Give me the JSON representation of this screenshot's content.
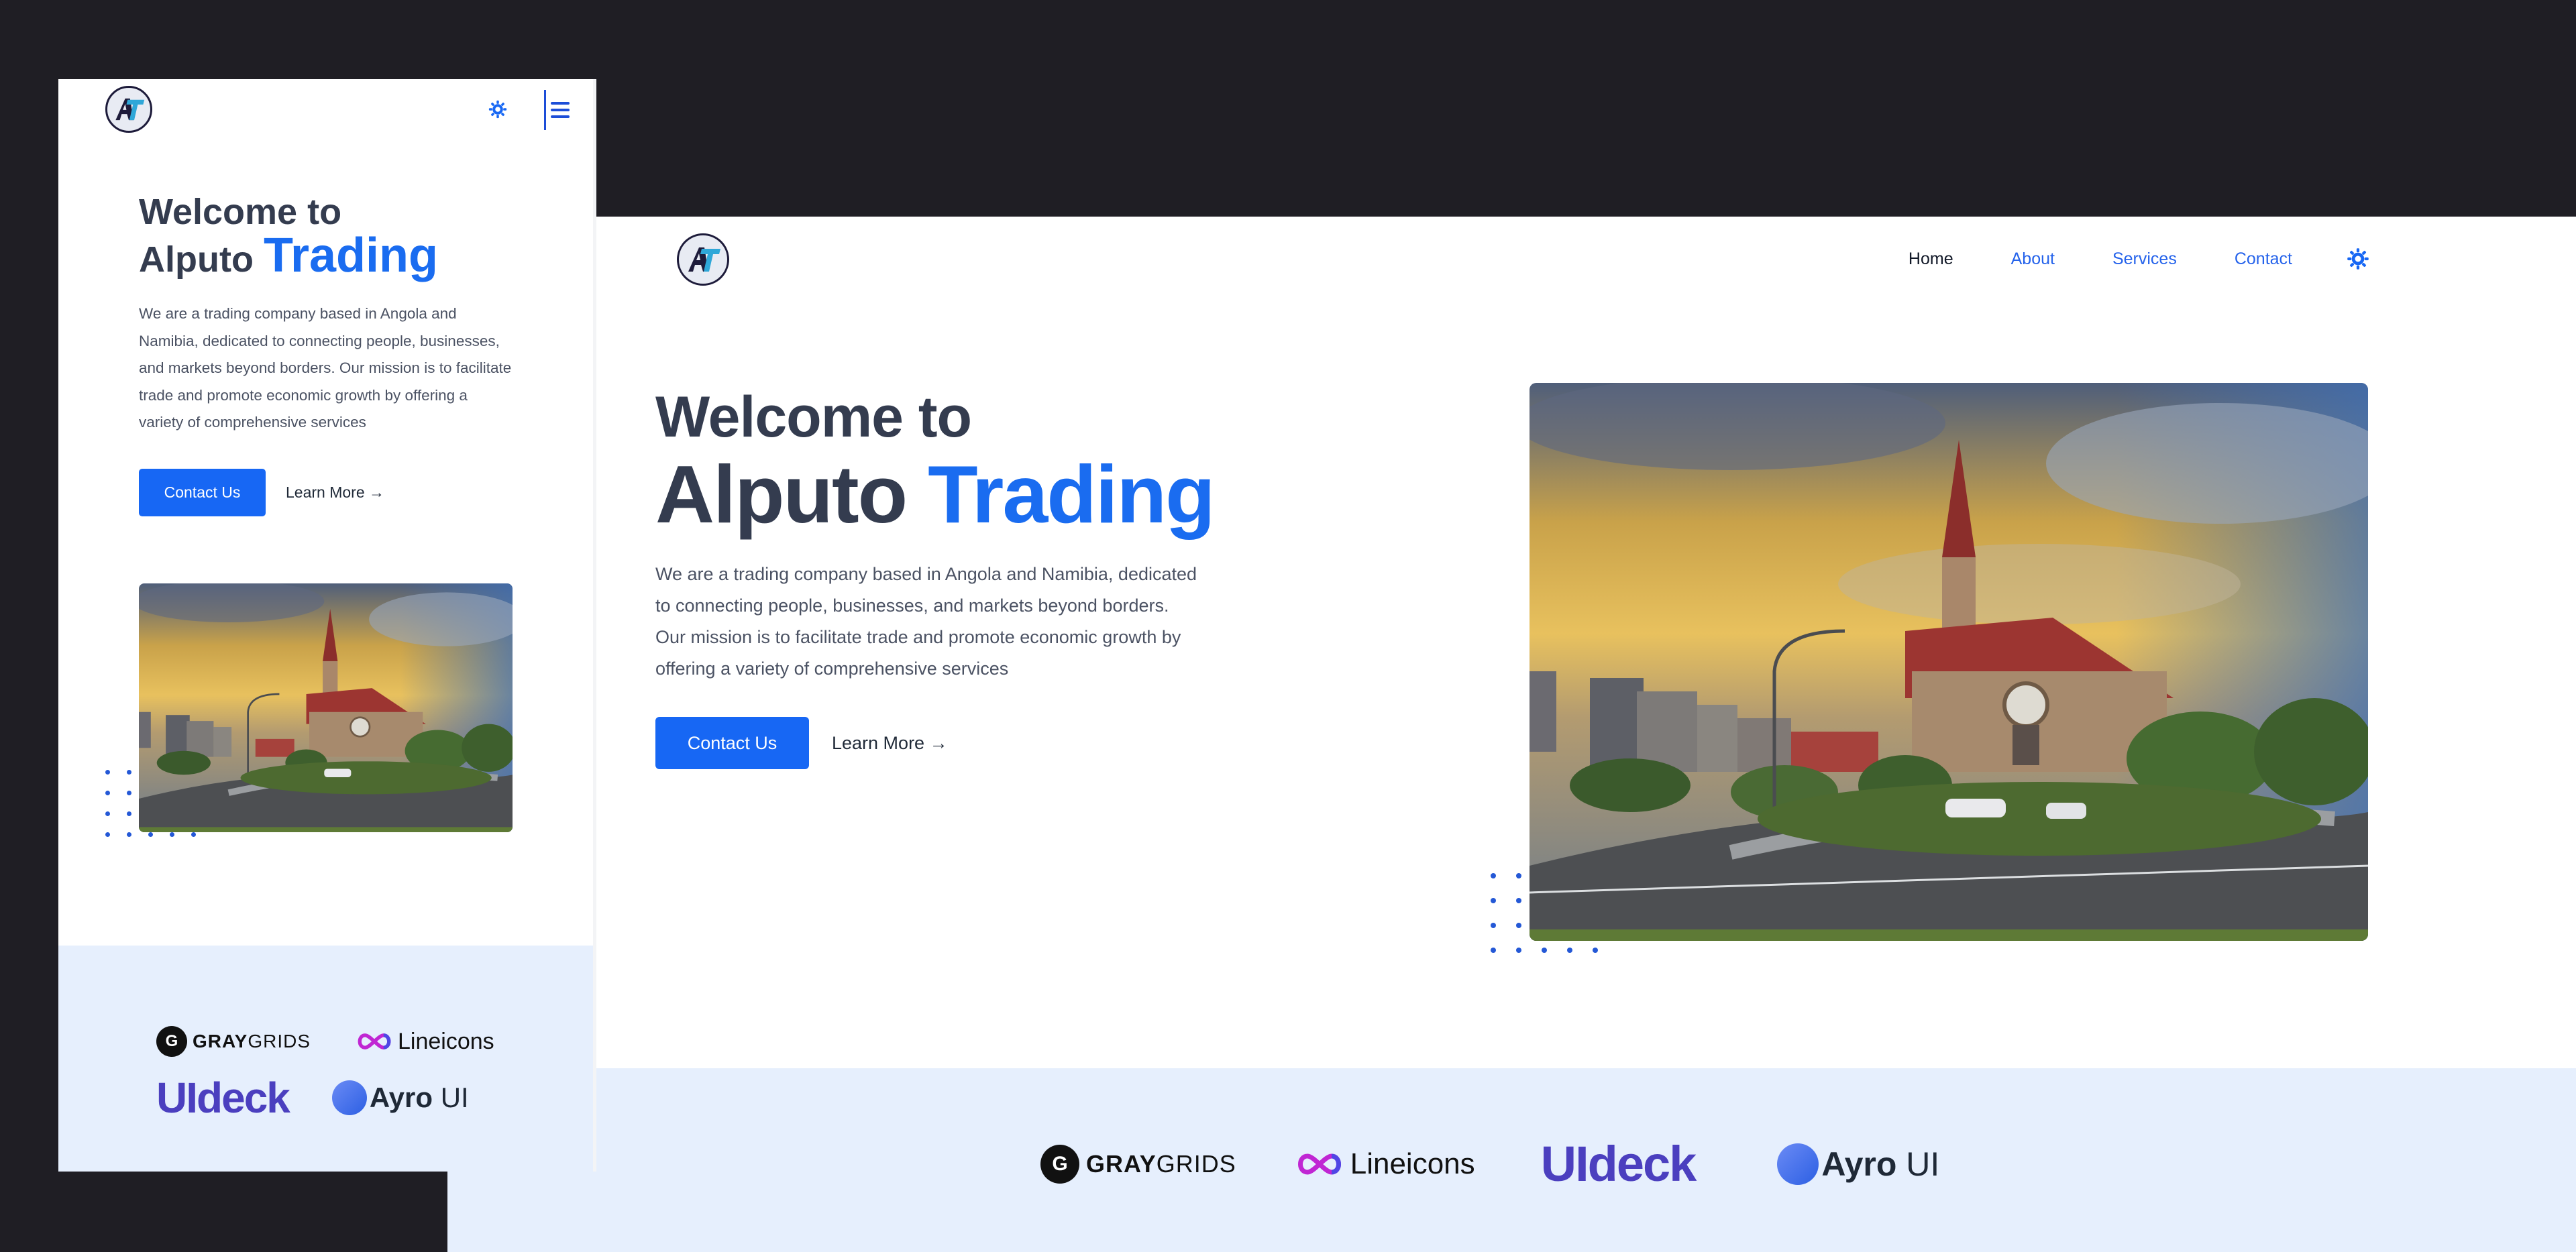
{
  "brand": {
    "logo_text": "AT",
    "accent_color": "#1a6cf0",
    "heading_color": "#343c4f"
  },
  "nav": {
    "items": [
      {
        "label": "Home",
        "active": true
      },
      {
        "label": "About",
        "active": false
      },
      {
        "label": "Services",
        "active": false
      },
      {
        "label": "Contact",
        "active": false
      }
    ],
    "theme_icon": "gear-icon",
    "menu_icon": "hamburger-icon"
  },
  "hero": {
    "title_line1": "Welcome to",
    "title_line2_plain": "Alputo",
    "title_line2_accent": "Trading",
    "description": "We are a trading company based in Angola and Namibia, dedicated to connecting people, businesses, and markets beyond borders. Our mission is to facilitate trade and promote economic growth by offering a variety of comprehensive services",
    "primary_button": "Contact Us",
    "secondary_link": "Learn More →",
    "image_alt": "Church with red roof at a roundabout under a sunset sky"
  },
  "brands": {
    "graygrids": {
      "bold": "GRAY",
      "light": "GRIDS"
    },
    "lineicons": "Lineicons",
    "uideck": "UIdeck",
    "ayro": {
      "bold": "Ayro",
      "light": "UI"
    }
  }
}
